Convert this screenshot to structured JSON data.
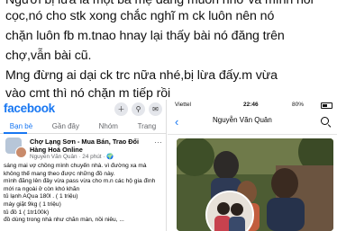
{
  "caption": {
    "lines": [
      "Người bị lừa là một bà mẹ đang muốn nhờ vả mình nói",
      "cọc,nó cho stk xong chắc nghĩ m ck luôn nên nó",
      "chặn luôn fb m.tnao hnay lại thấy bài nó đăng trên",
      "chợ,vẫn bài cũ.",
      "Mng đừng ai dại ck trc nữa nhé,bị lừa đấy.m vừa",
      "vào cmt thì nó chặn m tiếp rồi"
    ]
  },
  "left": {
    "app_name": "facebook",
    "icons": [
      "plus-icon",
      "search-icon",
      "messenger-icon"
    ],
    "tabs": [
      "Bạn bè",
      "Gần đây",
      "Nhóm",
      "Trang"
    ],
    "active_tab": "Bạn bè",
    "post": {
      "group_name": "Chợ Lạng Sơn - Mua Bán, Trao Đổi Hàng Hoá Online",
      "author_meta": "Nguyễn Văn Quân · 24 phút · 🌍",
      "more_label": "···",
      "body_lines": [
        "sáng mai vợ chồng mình chuyển nhà. vì đường xa mà",
        "không thể mang theo được những đồ này.",
        "mình đăng lên đây vừa pass vừa cho m.n các hộ gia đình",
        "mới ra ngoài ở còn khó khăn",
        "tủ lạnh AQua 180l . ( 1 triệu)",
        "máy giặt 9kg ( 1 triệu)",
        "tủ đồ 1 ( 1tr100k)",
        "đồ dùng trong nhà như chăn màn, nồi niêu, ..."
      ]
    }
  },
  "right": {
    "status": {
      "carrier": "Viettel",
      "time": "22:46",
      "battery": "80%"
    },
    "profile_name": "Nguyễn Văn Quân",
    "back_icon": "back-arrow-icon",
    "search_icon": "search-icon"
  }
}
